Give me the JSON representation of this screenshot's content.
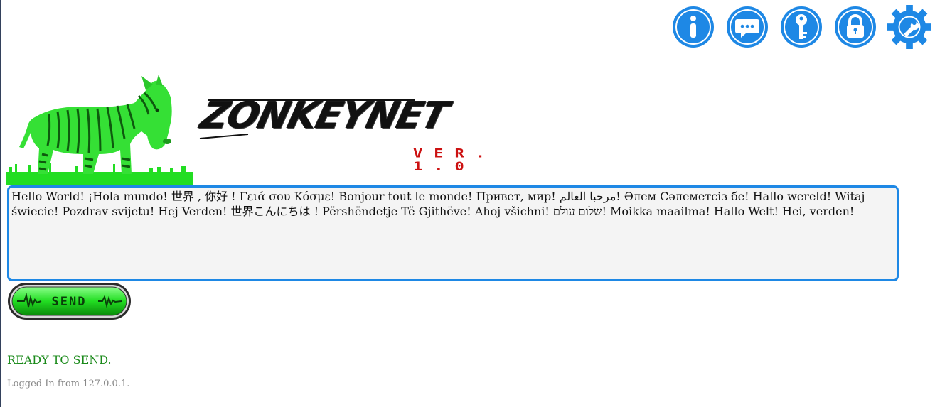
{
  "app": {
    "brand": "ZONKEYNET",
    "version": "VER. 1.0",
    "accent_color": "#1e88e5",
    "status_color": "#1a8a1a"
  },
  "toolbar": {
    "buttons": [
      {
        "name": "info",
        "icon": "info-icon"
      },
      {
        "name": "chat",
        "icon": "chat-icon"
      },
      {
        "name": "key",
        "icon": "key-icon"
      },
      {
        "name": "lock",
        "icon": "lock-icon"
      },
      {
        "name": "settings",
        "icon": "gear-wrench-icon"
      }
    ]
  },
  "message": {
    "text": "Hello World! ¡Hola mundo! 世界 , 你好 ! Γειά σου Κόσμε! Bonjour tout le monde! Привет, мир! مرحبا العالم! Әлем Сәлеметсіз бе! Hallo wereld! Witaj świecie! Pozdrav svijetu! Hej Verden! 世界こんにちは ! Përshëndetje Të Gjithëve! Ahoj všichni! שלום עולם! Moikka maailma! Hallo Welt! Hei, verden!"
  },
  "send_button": {
    "label": "SEND"
  },
  "status": {
    "text": "READY TO SEND.",
    "login": "Logged In from 127.0.0.1."
  }
}
